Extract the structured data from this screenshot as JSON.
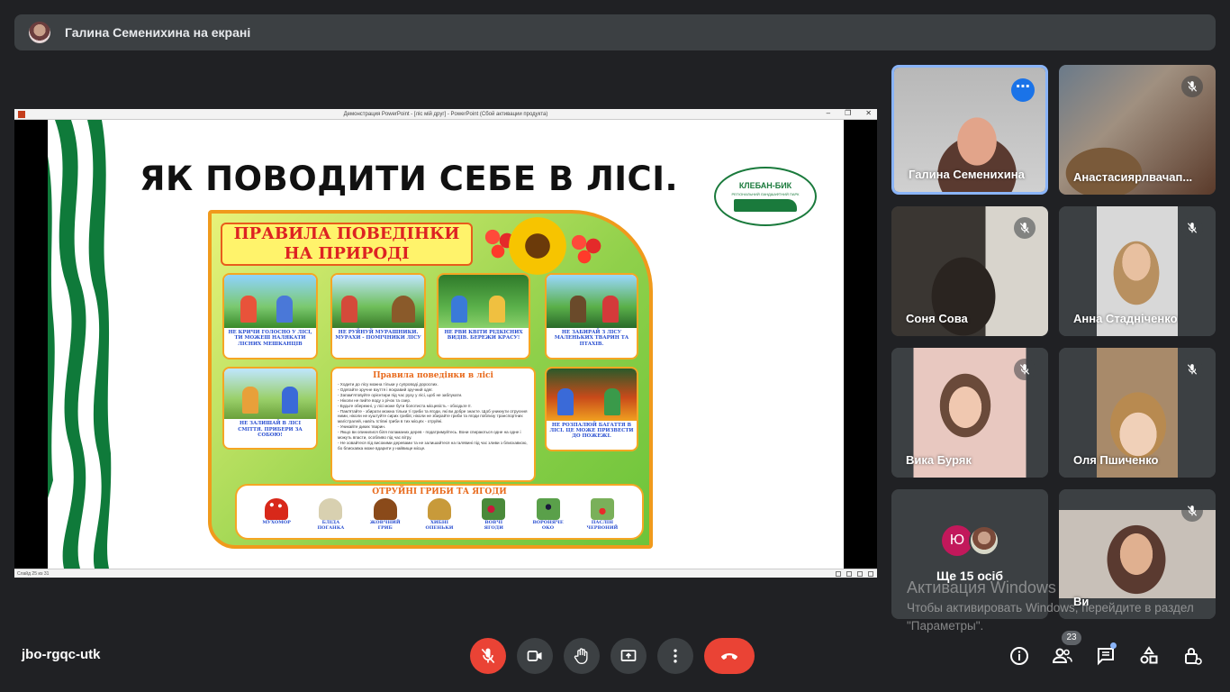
{
  "presenter_bar": {
    "text": "Галина Семенихина на екрані"
  },
  "ppt": {
    "window_title": "Демонстрация PowerPoint - [ліс мій друг] - PowerPoint (Сбой активации продукта)",
    "status": "Слайд 25 из 31"
  },
  "slide": {
    "title": "ЯК ПОВОДИТИ СЕБЕ В ЛІСІ.",
    "logo_text": "КЛЕБАН-БИК",
    "logo_sub": "РЕГІОНАЛЬНИЙ ЛАНДШАФТНИЙ ПАРК",
    "poster": {
      "heading_line1": "ПРАВИЛА ПОВЕДІНКИ",
      "heading_line2": "НА ПРИРОДІ",
      "cards": [
        "НЕ КРИЧИ ГОЛОСНО У ЛІСІ, ТИ МОЖЕШ НАЛЯКАТИ ЛІСНИХ МЕШКАНЦІВ",
        "НЕ РУЙНУЙ МУРАШНИКИ. МУРАХИ - ПОМІЧНИКИ ЛІСУ",
        "НЕ РВИ КВІТИ РІДКІСНИХ ВИДІВ. БЕРЕЖИ КРАСУ!",
        "НЕ ЗАБИРАЙ З ЛІСУ МАЛЕНЬКИХ ТВАРИН ТА ПТАХІВ.",
        "НЕ ЗАЛИШАЙ В ЛІСІ СМІТТЯ. ПРИБЕРИ ЗА СОБОЮ!",
        "НЕ РОЗПАЛЮЙ БАГАТТЯ В ЛІСІ. ЦЕ МОЖЕ ПРИЗВЕСТИ ДО ПОЖЕЖІ."
      ],
      "rules_title": "Правила поведінки в лісі",
      "rules_text": "- Ходити до лісу можна тільки у супроводі дорослих.\n- Одягайте зручне взуття і яскравий зручний одяг.\n- Запам'ятовуйте орієнтири під час руху у лісі, щоб не заблукати.\n- Ніколи не пийте воду з річок та озер.\n- Будьте обережні, у лісі може бути болотиста місцевість - обходьте її.\n- Пам'ятайте - збирати можна тільки ті гриби та ягоди, які ви добре знаєте. Щоб уникнути отруєння ними, ніколи не куштуйте сирих грибів; ніколи не збирайте гриби та ягоди поблизу транспортних магістралей, навіть їстівні гриби в тих місцях - отруйні.\n- Уникайте диких тварин.\n- Якщо ви опинилися біля поламаних дерев - податримуйтесь. Вони спираються одне на одне і можуть впасти, особливо під час вітру.\n- Не ховайтеся під високими деревами та не залишайтеся на галявині під час зливи з блискавкою, бо блискавка може вдарити у найвище місце.",
      "poison_title": "ОТРУЙНІ ГРИБИ ТА ЯГОДИ",
      "poison_items": [
        "МУХОМОР",
        "БЛІДА ПОГАНКА",
        "ЖОВЧНИЙ ГРИБ",
        "ХИБНІ ОПЕНЬКИ",
        "ВОВЧІ ЯГОДИ",
        "ВОРОНЯЧЕ ОКО",
        "ПАСЛІН ЧЕРВОНИЙ"
      ]
    }
  },
  "participants": [
    {
      "name": "Галина Семенихина",
      "active": true
    },
    {
      "name": "Анастасиярлвачап..."
    },
    {
      "name": "Соня Сова"
    },
    {
      "name": "Анна Стадніченко"
    },
    {
      "name": "Вика Буряк"
    },
    {
      "name": "Оля Пшиченко"
    },
    {
      "name": "Ви"
    }
  ],
  "more_tile": {
    "initial": "Ю",
    "label": "Ще 15 осіб"
  },
  "watermark": {
    "line1": "Активация Windows",
    "line2": "Чтобы активировать Windows, перейдите в раздел \"Параметры\"."
  },
  "bottom": {
    "meeting_code": "jbo-rgqc-utk",
    "people_count": "23"
  },
  "colors": {
    "end_call": "#ea4335",
    "active_border": "#8ab4f8",
    "background": "#202124"
  }
}
